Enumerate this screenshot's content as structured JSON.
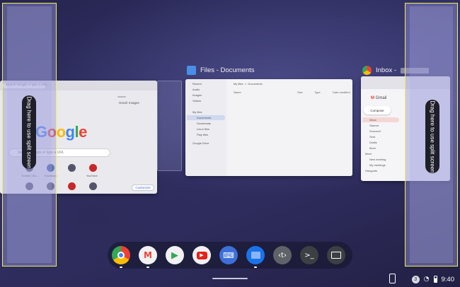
{
  "split_screen": {
    "left_hint": "Drag here to use split screen",
    "right_hint": "Drag here to use split screen"
  },
  "windows": {
    "chrome": {
      "omnibox_placeholder": "Search Google or type a URL",
      "google_logo": [
        "G",
        "o",
        "o",
        "g",
        "l",
        "e"
      ],
      "search_placeholder": "Search Google or type a URL",
      "header_links": [
        "Gmail",
        "Images"
      ],
      "shortcuts": [
        "Tumblr | Wo...",
        "Facebook",
        "",
        "YouTube"
      ],
      "customize": "Customize"
    },
    "files": {
      "title": "Files - Documents",
      "breadcrumb": "My files  >  Documents",
      "sidebar": [
        "Recent",
        "Audio",
        "Images",
        "Videos",
        "My files",
        "Documents",
        "Downloads",
        "Linux files",
        "Play files",
        "Google Drive"
      ],
      "columns": [
        "Name",
        "Size",
        "Type",
        "Date modified"
      ]
    },
    "gmail": {
      "title": "Inbox -",
      "logo_text": "Gmail",
      "compose": "Compose",
      "folders": [
        "Inbox",
        "Starred",
        "Snoozed",
        "Sent",
        "Drafts",
        "More",
        "Meet",
        "New meeting",
        "My meetings",
        "Hangouts"
      ]
    }
  },
  "shelf": {
    "apps": [
      "chrome-icon",
      "gmail-icon",
      "play-store-icon",
      "youtube-icon",
      "keyboard-icon",
      "files-icon",
      "code-icon",
      "terminal-icon",
      "screen-icon"
    ]
  },
  "status": {
    "notification_count": "3",
    "time": "9:40"
  },
  "colors": {
    "split_border": "#f2ee5a",
    "wallpaper": "#2b2a5a"
  }
}
